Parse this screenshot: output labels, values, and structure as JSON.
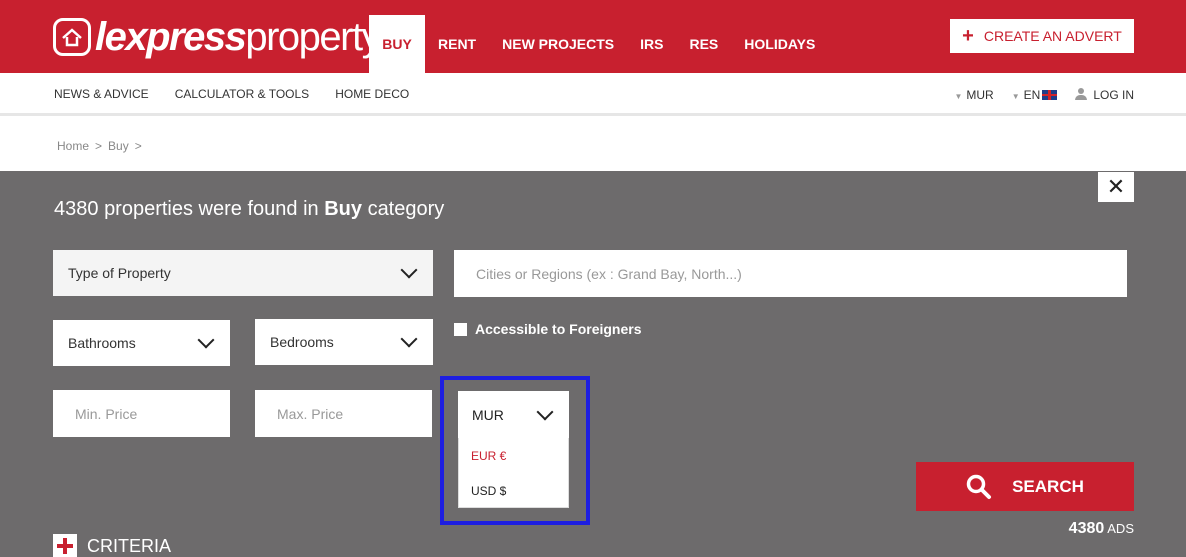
{
  "header": {
    "logo_bold": "lexpress",
    "logo_light": "property",
    "nav": [
      {
        "label": "BUY",
        "active": true
      },
      {
        "label": "RENT"
      },
      {
        "label": "NEW PROJECTS"
      },
      {
        "label": "IRS"
      },
      {
        "label": "RES"
      },
      {
        "label": "HOLIDAYS"
      }
    ],
    "advert_label": "CREATE AN ADVERT",
    "brand_color": "#c8202f"
  },
  "subnav": {
    "links": [
      "NEWS & ADVICE",
      "CALCULATOR & TOOLS",
      "HOME DECO"
    ],
    "currency": "MUR",
    "language": "EN",
    "login": "LOG IN"
  },
  "breadcrumb": [
    "Home",
    ">",
    "Buy",
    ">"
  ],
  "search": {
    "count": "4380",
    "title_mid": "properties were found in",
    "category": "Buy",
    "title_end": "category",
    "type_of_property": "Type of Property",
    "location_placeholder": "Cities or Regions (ex : Grand Bay, North...)",
    "bathrooms": "Bathrooms",
    "bedrooms": "Bedrooms",
    "foreigners_label": "Accessible to Foreigners",
    "min_price_placeholder": "Min. Price",
    "max_price_placeholder": "Max. Price",
    "currency_selected": "MUR",
    "currency_options": [
      "EUR €",
      "USD $"
    ],
    "search_label": "SEARCH",
    "ads_count": "4380",
    "ads_label": "ADS",
    "criteria_label": "CRITERIA",
    "close_symbol": "✕"
  }
}
